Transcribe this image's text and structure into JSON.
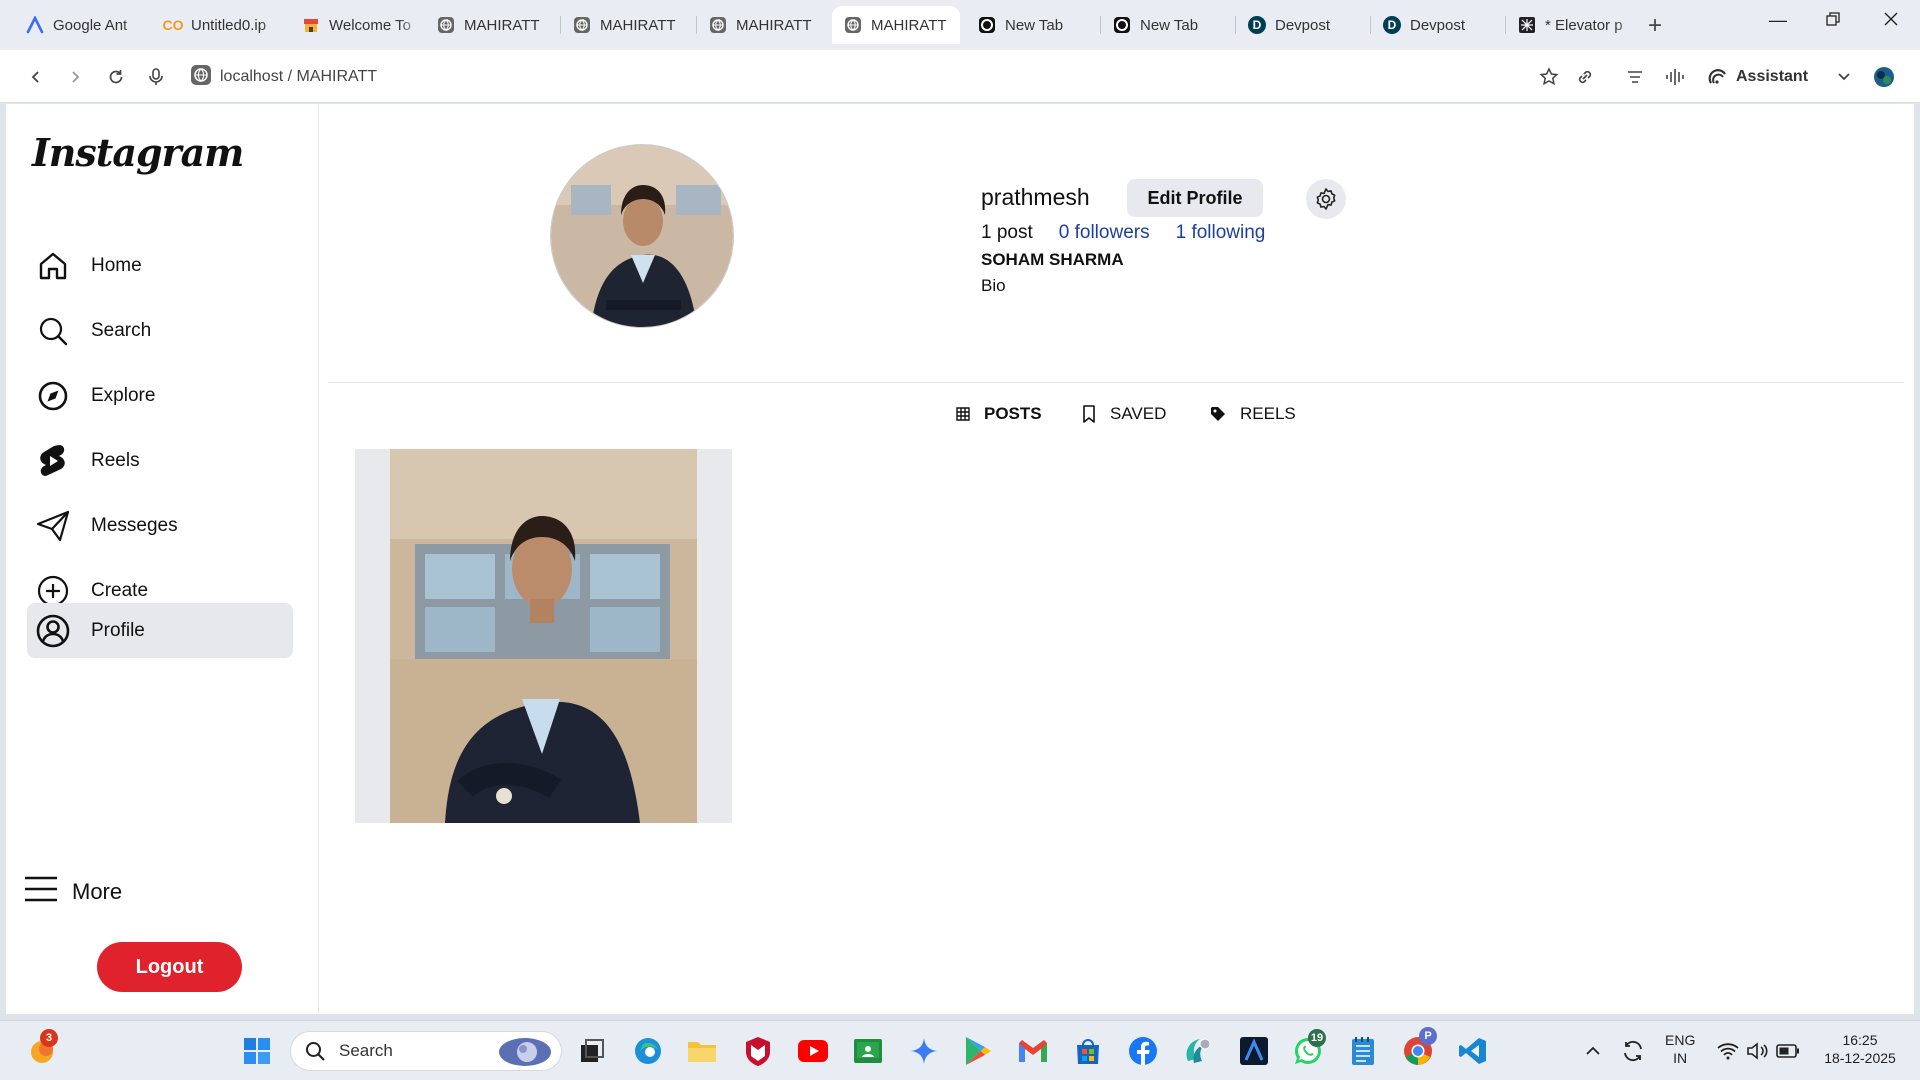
{
  "browser": {
    "tabs": [
      {
        "title": "Google Ant",
        "icon": "antigravity-icon"
      },
      {
        "title": "Untitled0.ip",
        "icon": "colab-icon"
      },
      {
        "title": "Welcome To",
        "icon": "store-icon"
      },
      {
        "title": "MAHIRATT",
        "icon": "globe-icon"
      },
      {
        "title": "MAHIRATT",
        "icon": "globe-icon"
      },
      {
        "title": "MAHIRATT",
        "icon": "globe-icon"
      },
      {
        "title": "MAHIRATT",
        "icon": "globe-icon",
        "active": true
      },
      {
        "title": "New Tab",
        "icon": "opera-icon"
      },
      {
        "title": "New Tab",
        "icon": "opera-icon"
      },
      {
        "title": "Devpost",
        "icon": "devpost-icon"
      },
      {
        "title": "Devpost",
        "icon": "devpost-icon"
      },
      {
        "title": "* Elevator p",
        "icon": "elevator-icon"
      }
    ],
    "url": "localhost / MAHIRATT",
    "assistant_label": "Assistant"
  },
  "sidebar": {
    "logo": "Instagram",
    "items": [
      {
        "label": "Home",
        "icon": "home-icon"
      },
      {
        "label": "Search",
        "icon": "search-icon"
      },
      {
        "label": "Explore",
        "icon": "compass-icon"
      },
      {
        "label": "Reels",
        "icon": "reels-icon"
      },
      {
        "label": "Messeges",
        "icon": "send-icon"
      },
      {
        "label": "Create",
        "icon": "plus-circle-icon"
      },
      {
        "label": "Profile",
        "icon": "user-circle-icon",
        "active": true
      }
    ],
    "more_label": "More",
    "logout_label": "Logout"
  },
  "profile": {
    "username": "prathmesh",
    "edit_label": "Edit Profile",
    "posts": "1 post",
    "followers": "0 followers",
    "following": "1 following",
    "full_name": "SOHAM SHARMA",
    "bio": "Bio",
    "tabs": [
      {
        "label": "POSTS",
        "icon": "grid-icon",
        "active": true
      },
      {
        "label": "SAVED",
        "icon": "bookmark-icon"
      },
      {
        "label": "REELS",
        "icon": "tag-icon"
      }
    ]
  },
  "taskbar": {
    "search_placeholder": "Search",
    "lang_line1": "ENG",
    "lang_line2": "IN",
    "time": "16:25",
    "date": "18-12-2025",
    "badge_weather": "3",
    "badge_whatsapp": "19",
    "badge_chrome": "P"
  },
  "colors": {
    "accent_link": "#1e3f9c",
    "logout": "#e0222c",
    "active_nav": "#e6e8ec"
  }
}
